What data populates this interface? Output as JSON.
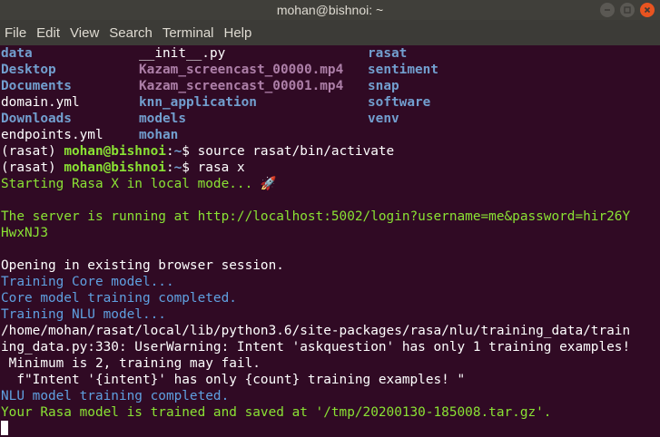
{
  "window": {
    "title": "mohan@bishnoi: ~",
    "controls": [
      "minimize",
      "maximize",
      "close"
    ]
  },
  "menu": [
    "File",
    "Edit",
    "View",
    "Search",
    "Terminal",
    "Help"
  ],
  "ls_listing": [
    [
      "data",
      "__init__.py",
      "rasat"
    ],
    [
      "Desktop",
      "Kazam_screencast_00000.mp4",
      "sentiment"
    ],
    [
      "Documents",
      "Kazam_screencast_00001.mp4",
      "snap"
    ],
    [
      "domain.yml",
      "knn_application",
      "software"
    ],
    [
      "Downloads",
      "models",
      "venv"
    ],
    [
      "endpoints.yml",
      "mohan",
      ""
    ]
  ],
  "prompt": {
    "env": "(rasat) ",
    "userhost": "mohan@bishnoi",
    "sep": ":",
    "path": "~",
    "dollar": "$ "
  },
  "commands": [
    "source rasat/bin/activate",
    "rasa x"
  ],
  "output": {
    "starting": "Starting Rasa X in local mode... 🚀",
    "server_running_1": "The server is running at http://localhost:5002/login?username=me&password=hir26Y",
    "server_running_2": "HwxNJ3",
    "opening": "Opening in existing browser session.",
    "training_core": "Training Core model...",
    "core_completed": "Core model training completed.",
    "training_nlu": "Training NLU model...",
    "warning_1": "/home/mohan/rasat/local/lib/python3.6/site-packages/rasa/nlu/training_data/train",
    "warning_2": "ing_data.py:330: UserWarning: Intent 'askquestion' has only 1 training examples!",
    "warning_3": " Minimum is 2, training may fail.",
    "warning_4": "  f\"Intent '{intent}' has only {count} training examples! \"",
    "nlu_completed": "NLU model training completed.",
    "saved": "Your Rasa model is trained and saved at '/tmp/20200130-185008.tar.gz'."
  }
}
